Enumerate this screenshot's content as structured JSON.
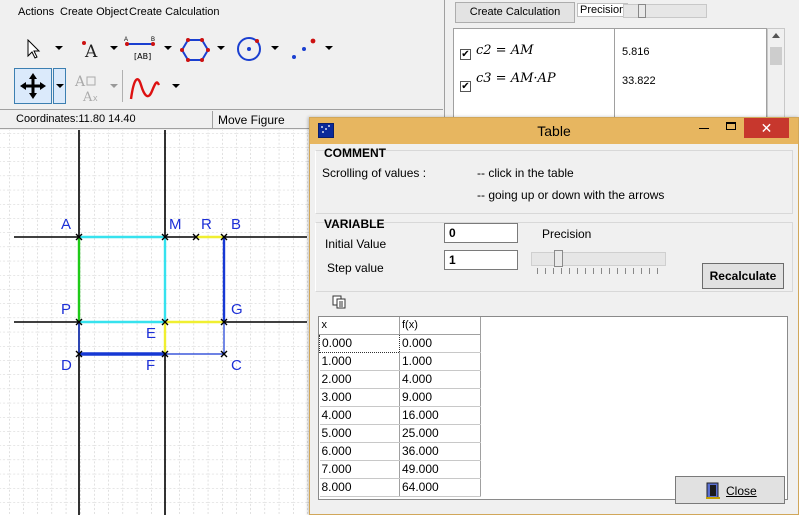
{
  "menu": [
    "Actions",
    "Create Object",
    "Create Calculation"
  ],
  "status": {
    "coordinates": "Coordinates:11.80 14.40",
    "mode": "Move Figure"
  },
  "canvas": {
    "points": [
      "A",
      "M",
      "R",
      "B",
      "P",
      "G",
      "E",
      "D",
      "F",
      "C"
    ],
    "colors": {
      "cyan": "#36e2ee",
      "blue": "#1638d4",
      "green": "#1fca18",
      "yellow": "#f0ef30",
      "label": "#1c2fd6"
    }
  },
  "calc_panel": {
    "create_button": "Create Calculation",
    "precision_label": "Precision",
    "rows": [
      {
        "expr": "c2 = AM",
        "value": "5.816",
        "checked": true
      },
      {
        "expr": "c3 = AM·AP",
        "value": "33.822",
        "checked": true
      }
    ]
  },
  "dialog": {
    "title": "Table",
    "comment_title": "COMMENT",
    "scrolling_label": "Scrolling of values :",
    "hint_click": "-- click in the table",
    "hint_arrows": "-- going up or down with the arrows",
    "variable_title": "VARIABLE",
    "initial_label": "Initial Value",
    "initial_value": "0",
    "step_label": "Step value",
    "step_value": "1",
    "precision_label": "Precision",
    "recalc_label": "Recalculate",
    "close_label": "Close",
    "table": {
      "headers": [
        "x",
        "f(x)"
      ],
      "rows": [
        [
          "0.000",
          "0.000"
        ],
        [
          "1.000",
          "1.000"
        ],
        [
          "2.000",
          "4.000"
        ],
        [
          "3.000",
          "9.000"
        ],
        [
          "4.000",
          "16.000"
        ],
        [
          "5.000",
          "25.000"
        ],
        [
          "6.000",
          "36.000"
        ],
        [
          "7.000",
          "49.000"
        ],
        [
          "8.000",
          "64.000"
        ]
      ]
    },
    "colors": {
      "title_bar": "#e7b660",
      "close_x": "#c7372d"
    }
  }
}
